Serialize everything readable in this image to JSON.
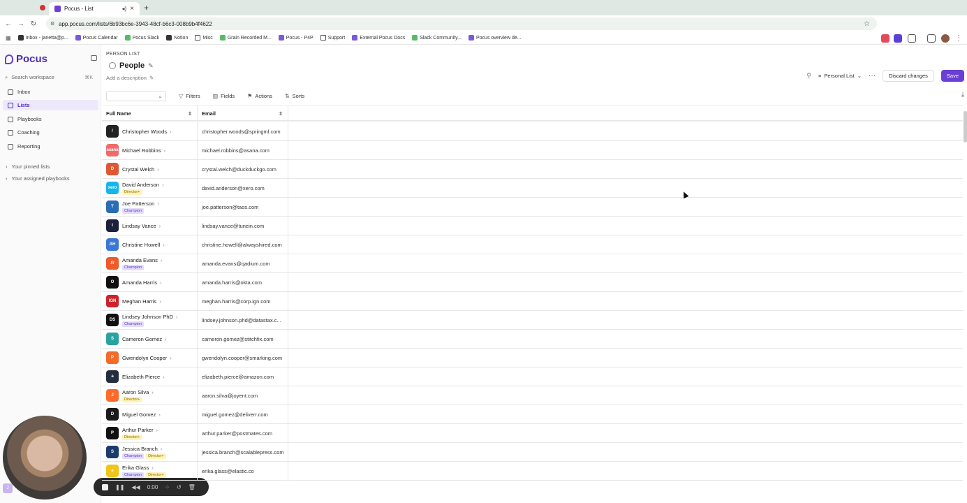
{
  "browser": {
    "tab_title": "Pocus - List",
    "url": "app.pocus.com/lists/6b93bc6e-3943-48cf-b6c3-008b9b4f4622",
    "bookmarks": [
      "Inbox - janetta@p...",
      "Pocus Calendar",
      "Pocus Slack",
      "Notion",
      "Misc",
      "Grain Recorded M...",
      "Pocus - P4P",
      "Support",
      "External Pocus Docs",
      "Slack Community...",
      "Pocus overview de..."
    ]
  },
  "sidebar": {
    "brand": "Pocus",
    "search_placeholder": "Search workspace",
    "search_shortcut": "⌘K",
    "items": [
      {
        "label": "Inbox",
        "active": false
      },
      {
        "label": "Lists",
        "active": true
      },
      {
        "label": "Playbooks",
        "active": false
      },
      {
        "label": "Coaching",
        "active": false
      },
      {
        "label": "Reporting",
        "active": false
      }
    ],
    "sections": [
      "Your pinned lists",
      "Your assigned playbooks"
    ],
    "user_initial": "J"
  },
  "recorder": {
    "time": "0:00"
  },
  "header": {
    "crumb": "PERSON LIST",
    "title": "People",
    "description": "Add a description",
    "list_type": "Personal List",
    "discard_label": "Discard changes",
    "save_label": "Save"
  },
  "toolbar": {
    "filters": "Filters",
    "fields": "Fields",
    "actions": "Actions",
    "sorts": "Sorts"
  },
  "table": {
    "columns": [
      "Full Name",
      "Email"
    ],
    "rows": [
      {
        "name": "Christopher Woods",
        "email": "christopher.woods@springml.com",
        "badges": [],
        "logo": "#222",
        "abbr": "/"
      },
      {
        "name": "Michael Robbins",
        "email": "michael.robbins@asana.com",
        "badges": [],
        "logo": "#f06a6a",
        "abbr": "asana"
      },
      {
        "name": "Crystal Welch",
        "email": "crystal.welch@duckduckgo.com",
        "badges": [],
        "logo": "#de5833",
        "abbr": "D"
      },
      {
        "name": "David Anderson",
        "email": "david.anderson@xero.com",
        "badges": [
          "Director+"
        ],
        "logo": "#13b5ea",
        "abbr": "xero"
      },
      {
        "name": "Joe Patterson",
        "email": "joe.patterson@taos.com",
        "badges": [
          "Champion"
        ],
        "logo": "#2a6db5",
        "abbr": "T"
      },
      {
        "name": "Lindsay Vance",
        "email": "lindsay.vance@tunein.com",
        "badges": [],
        "logo": "#1c203c",
        "abbr": "t"
      },
      {
        "name": "Christine Howell",
        "email": "christine.howell@alwayshired.com",
        "badges": [],
        "logo": "#3a78d8",
        "abbr": "AH"
      },
      {
        "name": "Amanda Evans",
        "email": "amanda.evans@qadium.com",
        "badges": [
          "Champion"
        ],
        "logo": "#f05a28",
        "abbr": "///"
      },
      {
        "name": "Amanda Harris",
        "email": "amanda.harris@okta.com",
        "badges": [],
        "logo": "#111",
        "abbr": "O"
      },
      {
        "name": "Meghan Harris",
        "email": "meghan.harris@corp.ign.com",
        "badges": [],
        "logo": "#d0202a",
        "abbr": "IGN"
      },
      {
        "name": "Lindsey Johnson PhD",
        "email": "lindsey.johnson.phd@datastax.c...",
        "badges": [
          "Champion"
        ],
        "logo": "#111",
        "abbr": "DS"
      },
      {
        "name": "Cameron Gomez",
        "email": "cameron.gomez@stitchfix.com",
        "badges": [],
        "logo": "#2aa3a0",
        "abbr": "S"
      },
      {
        "name": "Gwendolyn Cooper",
        "email": "gwendolyn.cooper@smarking.com",
        "badges": [],
        "logo": "#f26b2a",
        "abbr": "P"
      },
      {
        "name": "Elizabeth Pierce",
        "email": "elizabeth.pierce@amazon.com",
        "badges": [],
        "logo": "#232f3e",
        "abbr": "a"
      },
      {
        "name": "Aaron Silva",
        "email": "aaron.silva@joyent.com",
        "badges": [
          "Director+"
        ],
        "logo": "#ff6a2a",
        "abbr": "J"
      },
      {
        "name": "Miguel Gomez",
        "email": "miguel.gomez@deliverr.com",
        "badges": [],
        "logo": "#1b1b1b",
        "abbr": "D"
      },
      {
        "name": "Arthur Parker",
        "email": "arthur.parker@postmates.com",
        "badges": [
          "Director+"
        ],
        "logo": "#111",
        "abbr": "P"
      },
      {
        "name": "Jessica Branch",
        "email": "jessica.branch@scalablepress.com",
        "badges": [
          "Champion",
          "Director+"
        ],
        "logo": "#1a3d6b",
        "abbr": "S"
      },
      {
        "name": "Erika Glass",
        "email": "erika.glass@elastic.co",
        "badges": [
          "Champion",
          "Director+"
        ],
        "logo": "#f0c419",
        "abbr": "e"
      }
    ]
  },
  "colors": {
    "accent": "#6b3fd6",
    "champion_bg": "#e4dcfb",
    "director_bg": "#fff3b8"
  }
}
